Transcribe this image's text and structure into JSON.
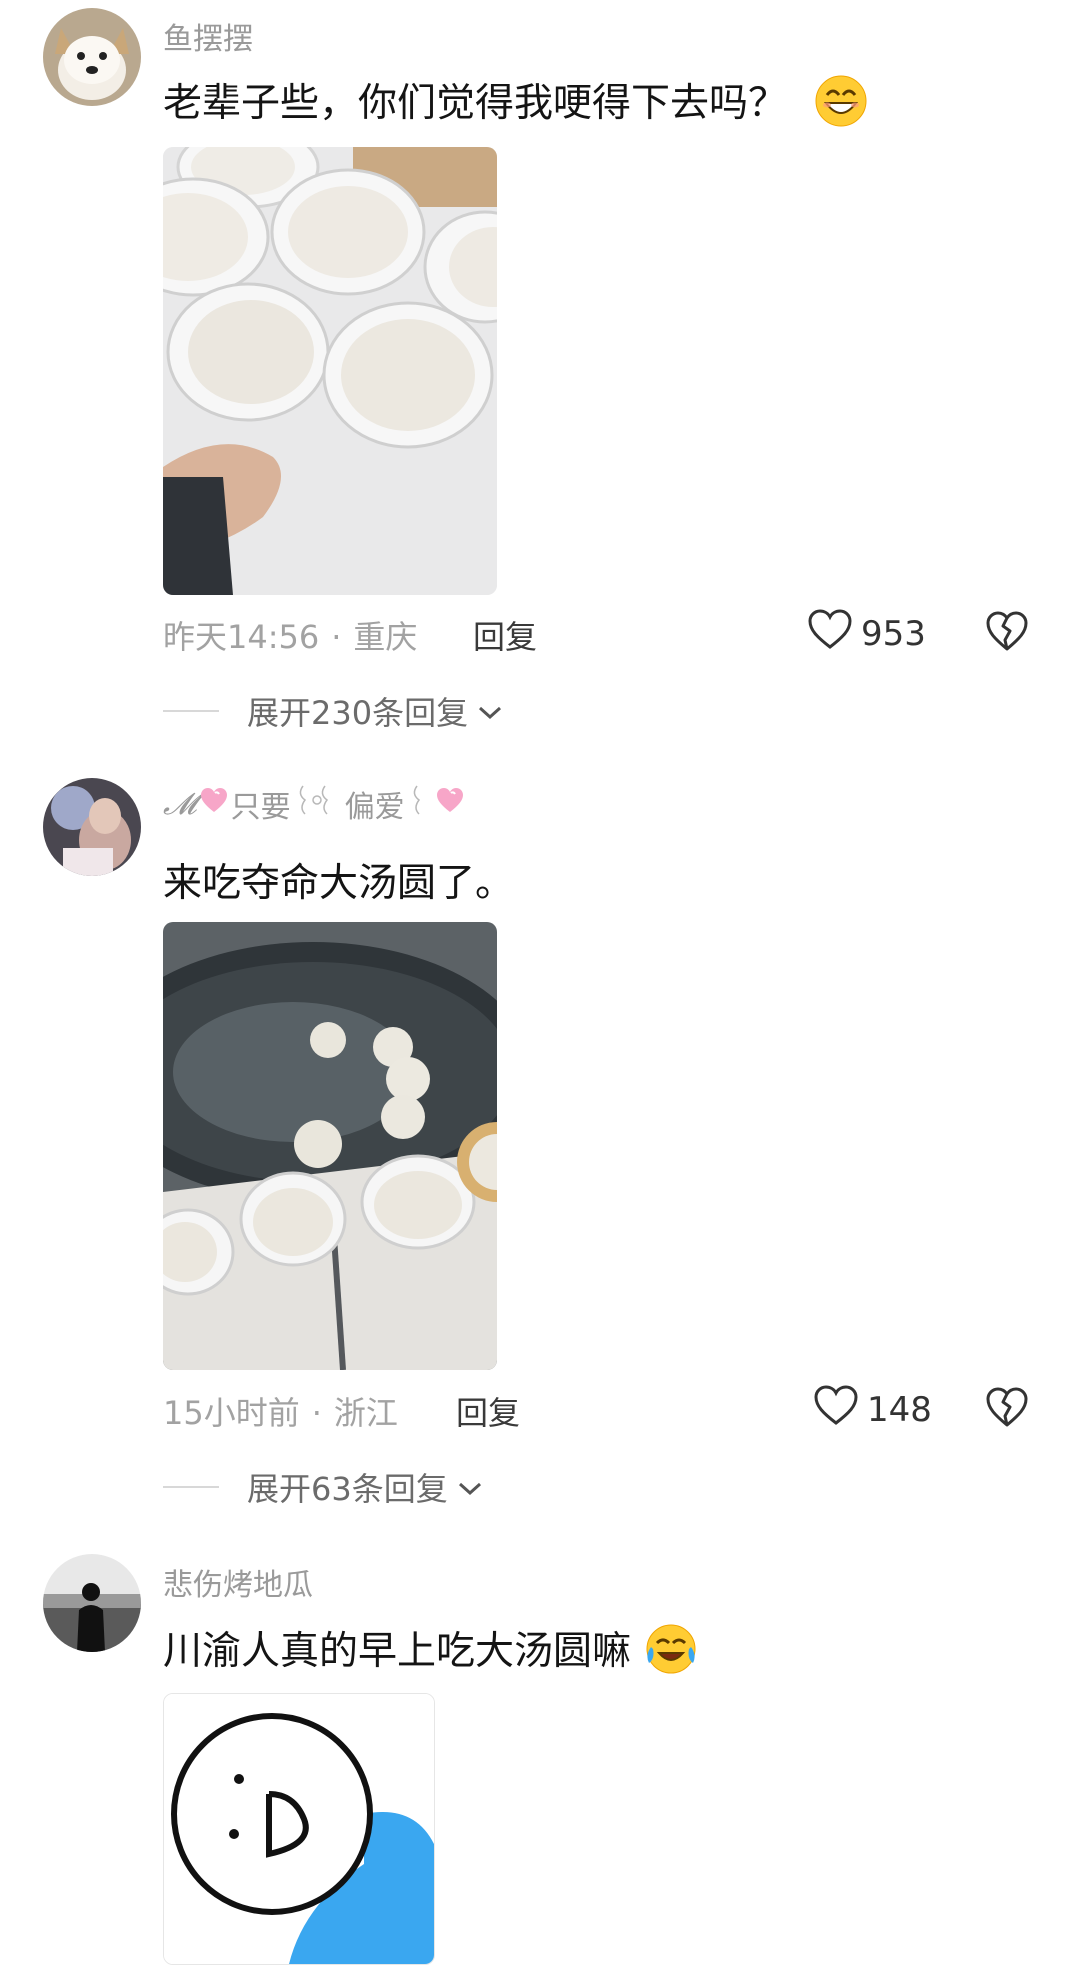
{
  "comments": [
    {
      "username": "鱼摆摆",
      "text": "老辈子些，你们觉得我哽得下去吗？",
      "time": "昨天14:56",
      "location": "重庆",
      "reply_label": "回复",
      "likes": "953",
      "expand_label": "展开230条回复",
      "emoji": "grin-emoji"
    },
    {
      "username": "𝓜💞只要੭ ੭偏爱੭ ੭💞",
      "username_parts": [
        "𝓜",
        "只要",
        "偏爱"
      ],
      "text": "来吃夺命大汤圆了。",
      "time": "15小时前",
      "location": "浙江",
      "reply_label": "回复",
      "likes": "148",
      "expand_label": "展开63条回复"
    },
    {
      "username": "悲伤烤地瓜",
      "text": "川渝人真的早上吃大汤圆嘛",
      "emoji": "crying-laugh-emoji"
    }
  ],
  "colors": {
    "username": "#9a9a9a",
    "meta": "#a2a2a2",
    "accent_blue": "#3aa7f0"
  }
}
